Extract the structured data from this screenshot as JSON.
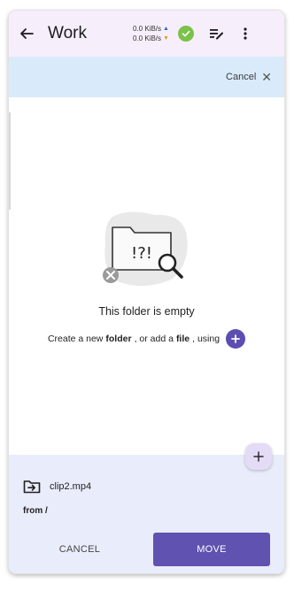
{
  "appbar": {
    "title": "Work",
    "upload_speed": "0.0 KiB/s",
    "download_speed": "0.0 KiB/s",
    "icons": [
      "back-arrow-icon",
      "check-icon",
      "playlist-edit-icon",
      "more-vert-icon"
    ]
  },
  "banner": {
    "cancel_label": "Cancel",
    "close_glyph": "✕"
  },
  "empty_state": {
    "illustration_text": "!?!",
    "title": "This folder is empty",
    "subtitle_prefix": "Create a new ",
    "subtitle_folder": "folder",
    "subtitle_middle": ", or add a ",
    "subtitle_file": "file",
    "subtitle_suffix": ", using"
  },
  "move_panel": {
    "file_name": "clip2.mp4",
    "from_text": "from /",
    "cancel_label": "CANCEL",
    "move_label": "MOVE"
  },
  "colors": {
    "appbar_bg": "#f6effb",
    "banner_bg": "#d9ebfa",
    "accent": "#5f52b0",
    "status_ok": "#7cc14a",
    "panel_bg": "#e9ecfa"
  }
}
